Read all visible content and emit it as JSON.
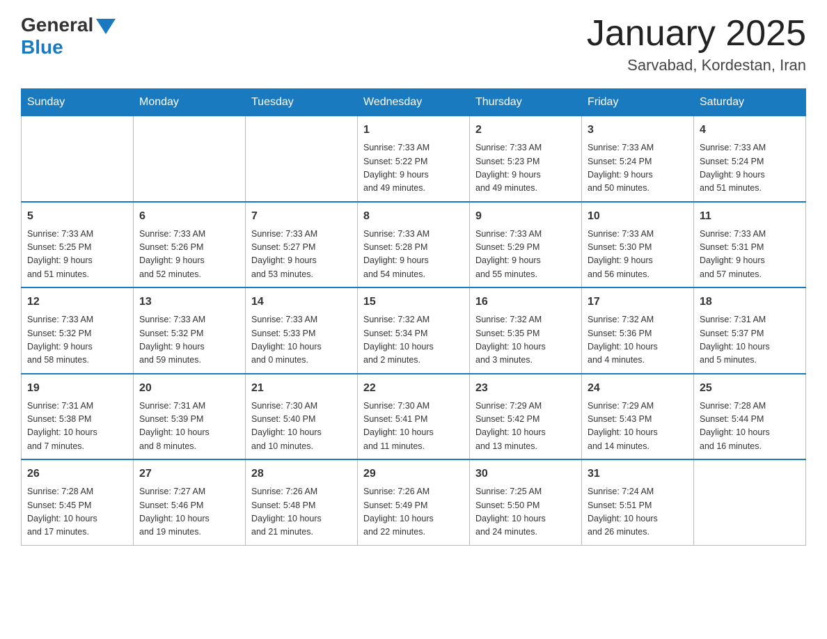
{
  "header": {
    "logo_general": "General",
    "logo_blue": "Blue",
    "title": "January 2025",
    "subtitle": "Sarvabad, Kordestan, Iran"
  },
  "weekdays": [
    "Sunday",
    "Monday",
    "Tuesday",
    "Wednesday",
    "Thursday",
    "Friday",
    "Saturday"
  ],
  "weeks": [
    [
      {
        "day": "",
        "info": ""
      },
      {
        "day": "",
        "info": ""
      },
      {
        "day": "",
        "info": ""
      },
      {
        "day": "1",
        "info": "Sunrise: 7:33 AM\nSunset: 5:22 PM\nDaylight: 9 hours\nand 49 minutes."
      },
      {
        "day": "2",
        "info": "Sunrise: 7:33 AM\nSunset: 5:23 PM\nDaylight: 9 hours\nand 49 minutes."
      },
      {
        "day": "3",
        "info": "Sunrise: 7:33 AM\nSunset: 5:24 PM\nDaylight: 9 hours\nand 50 minutes."
      },
      {
        "day": "4",
        "info": "Sunrise: 7:33 AM\nSunset: 5:24 PM\nDaylight: 9 hours\nand 51 minutes."
      }
    ],
    [
      {
        "day": "5",
        "info": "Sunrise: 7:33 AM\nSunset: 5:25 PM\nDaylight: 9 hours\nand 51 minutes."
      },
      {
        "day": "6",
        "info": "Sunrise: 7:33 AM\nSunset: 5:26 PM\nDaylight: 9 hours\nand 52 minutes."
      },
      {
        "day": "7",
        "info": "Sunrise: 7:33 AM\nSunset: 5:27 PM\nDaylight: 9 hours\nand 53 minutes."
      },
      {
        "day": "8",
        "info": "Sunrise: 7:33 AM\nSunset: 5:28 PM\nDaylight: 9 hours\nand 54 minutes."
      },
      {
        "day": "9",
        "info": "Sunrise: 7:33 AM\nSunset: 5:29 PM\nDaylight: 9 hours\nand 55 minutes."
      },
      {
        "day": "10",
        "info": "Sunrise: 7:33 AM\nSunset: 5:30 PM\nDaylight: 9 hours\nand 56 minutes."
      },
      {
        "day": "11",
        "info": "Sunrise: 7:33 AM\nSunset: 5:31 PM\nDaylight: 9 hours\nand 57 minutes."
      }
    ],
    [
      {
        "day": "12",
        "info": "Sunrise: 7:33 AM\nSunset: 5:32 PM\nDaylight: 9 hours\nand 58 minutes."
      },
      {
        "day": "13",
        "info": "Sunrise: 7:33 AM\nSunset: 5:32 PM\nDaylight: 9 hours\nand 59 minutes."
      },
      {
        "day": "14",
        "info": "Sunrise: 7:33 AM\nSunset: 5:33 PM\nDaylight: 10 hours\nand 0 minutes."
      },
      {
        "day": "15",
        "info": "Sunrise: 7:32 AM\nSunset: 5:34 PM\nDaylight: 10 hours\nand 2 minutes."
      },
      {
        "day": "16",
        "info": "Sunrise: 7:32 AM\nSunset: 5:35 PM\nDaylight: 10 hours\nand 3 minutes."
      },
      {
        "day": "17",
        "info": "Sunrise: 7:32 AM\nSunset: 5:36 PM\nDaylight: 10 hours\nand 4 minutes."
      },
      {
        "day": "18",
        "info": "Sunrise: 7:31 AM\nSunset: 5:37 PM\nDaylight: 10 hours\nand 5 minutes."
      }
    ],
    [
      {
        "day": "19",
        "info": "Sunrise: 7:31 AM\nSunset: 5:38 PM\nDaylight: 10 hours\nand 7 minutes."
      },
      {
        "day": "20",
        "info": "Sunrise: 7:31 AM\nSunset: 5:39 PM\nDaylight: 10 hours\nand 8 minutes."
      },
      {
        "day": "21",
        "info": "Sunrise: 7:30 AM\nSunset: 5:40 PM\nDaylight: 10 hours\nand 10 minutes."
      },
      {
        "day": "22",
        "info": "Sunrise: 7:30 AM\nSunset: 5:41 PM\nDaylight: 10 hours\nand 11 minutes."
      },
      {
        "day": "23",
        "info": "Sunrise: 7:29 AM\nSunset: 5:42 PM\nDaylight: 10 hours\nand 13 minutes."
      },
      {
        "day": "24",
        "info": "Sunrise: 7:29 AM\nSunset: 5:43 PM\nDaylight: 10 hours\nand 14 minutes."
      },
      {
        "day": "25",
        "info": "Sunrise: 7:28 AM\nSunset: 5:44 PM\nDaylight: 10 hours\nand 16 minutes."
      }
    ],
    [
      {
        "day": "26",
        "info": "Sunrise: 7:28 AM\nSunset: 5:45 PM\nDaylight: 10 hours\nand 17 minutes."
      },
      {
        "day": "27",
        "info": "Sunrise: 7:27 AM\nSunset: 5:46 PM\nDaylight: 10 hours\nand 19 minutes."
      },
      {
        "day": "28",
        "info": "Sunrise: 7:26 AM\nSunset: 5:48 PM\nDaylight: 10 hours\nand 21 minutes."
      },
      {
        "day": "29",
        "info": "Sunrise: 7:26 AM\nSunset: 5:49 PM\nDaylight: 10 hours\nand 22 minutes."
      },
      {
        "day": "30",
        "info": "Sunrise: 7:25 AM\nSunset: 5:50 PM\nDaylight: 10 hours\nand 24 minutes."
      },
      {
        "day": "31",
        "info": "Sunrise: 7:24 AM\nSunset: 5:51 PM\nDaylight: 10 hours\nand 26 minutes."
      },
      {
        "day": "",
        "info": ""
      }
    ]
  ]
}
